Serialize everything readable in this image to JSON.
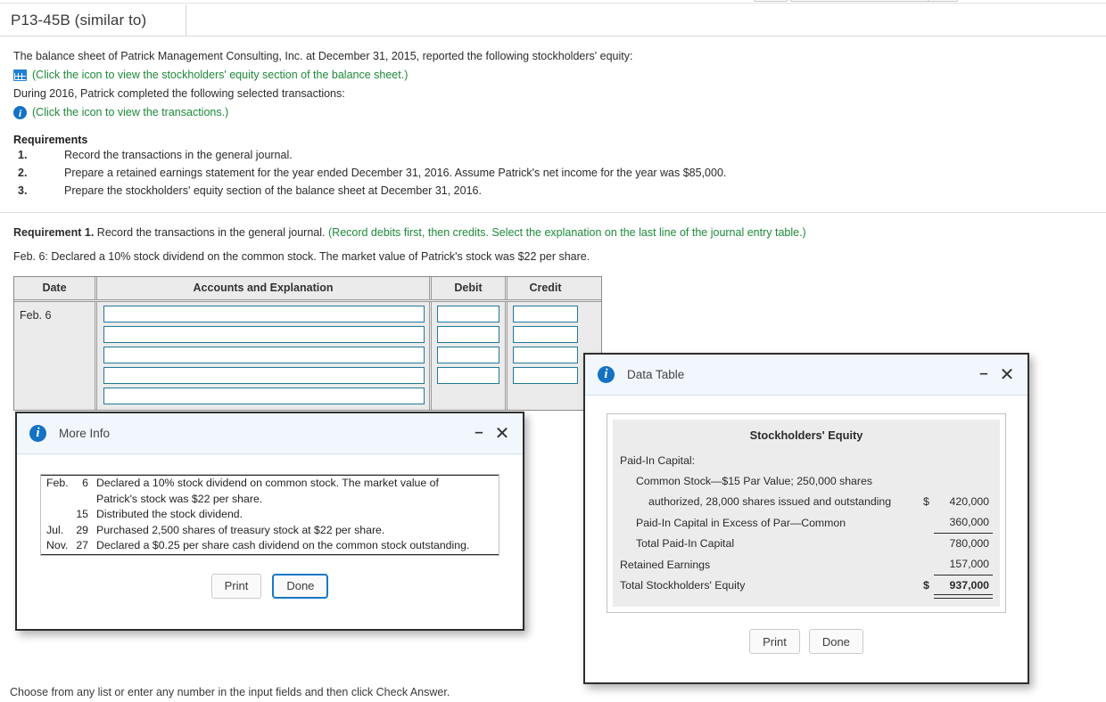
{
  "header": {
    "tab_title": "P13-45B (similar to)"
  },
  "problem": {
    "intro": "The balance sheet of Patrick Management Consulting, Inc. at December 31, 2015, reported the following stockholders' equity:",
    "balance_sheet_link": "(Click the icon to view the stockholders' equity section of the balance sheet.)",
    "balance_sheet_icon": "grid-table-icon",
    "during_line": "During 2016, Patrick completed the following selected transactions:",
    "transactions_link": "(Click the icon to view the transactions.)",
    "transactions_icon": "info-circle-icon",
    "requirements_heading": "Requirements",
    "requirements": [
      {
        "num": "1.",
        "text": "Record the transactions in the general journal."
      },
      {
        "num": "2.",
        "text": "Prepare a retained earnings statement for the year ended December 31, 2016. Assume Patrick's net income for the year was $85,000."
      },
      {
        "num": "3.",
        "text": "Prepare the stockholders' equity section of the balance sheet at December 31, 2016."
      }
    ]
  },
  "requirement1": {
    "label": "Requirement 1.",
    "instruction": "Record the transactions in the general journal.",
    "hint": "(Record debits first, then credits. Select the explanation on the last line of the journal entry table.)",
    "transaction_line": "Feb. 6: Declared a 10% stock dividend on the common stock. The market value of Patrick's stock was $22 per share."
  },
  "journal": {
    "columns": [
      "Date",
      "Accounts and Explanation",
      "Debit",
      "Credit"
    ],
    "date_value": "Feb. 6",
    "row_count": 5,
    "rows": [
      {
        "account": "",
        "debit": "",
        "credit": ""
      },
      {
        "account": "",
        "debit": "",
        "credit": ""
      },
      {
        "account": "",
        "debit": "",
        "credit": ""
      },
      {
        "account": "",
        "debit": "",
        "credit": ""
      },
      {
        "account": "",
        "debit": "",
        "credit": ""
      }
    ]
  },
  "more_info_dialog": {
    "title": "More Info",
    "icon": "info-circle-icon",
    "minimize_glyph": "–",
    "close_glyph": "✕",
    "transactions": [
      {
        "month": "Feb.",
        "day": "6",
        "text": "Declared a 10% stock dividend on common stock. The market value of"
      },
      {
        "month": "",
        "day": "",
        "text": "Patrick's stock was $22 per share."
      },
      {
        "month": "",
        "day": "15",
        "text": "Distributed the stock dividend."
      },
      {
        "month": "Jul.",
        "day": "29",
        "text": "Purchased 2,500 shares of treasury stock at $22 per share."
      },
      {
        "month": "Nov.",
        "day": "27",
        "text": "Declared a $0.25 per share cash dividend on the common stock outstanding."
      }
    ],
    "print_label": "Print",
    "done_label": "Done"
  },
  "data_table_dialog": {
    "title": "Data Table",
    "icon": "info-circle-icon",
    "minimize_glyph": "–",
    "close_glyph": "✕",
    "table_title": "Stockholders' Equity",
    "rows": [
      {
        "label": "Paid-In Capital:",
        "indent": 0,
        "currency": "",
        "amount": "",
        "rule": "none",
        "bold": false
      },
      {
        "label": "Common Stock—$15 Par Value; 250,000 shares",
        "indent": 1,
        "currency": "",
        "amount": "",
        "rule": "none",
        "bold": false
      },
      {
        "label": "authorized, 28,000 shares issued and outstanding",
        "indent": 2,
        "currency": "$",
        "amount": "420,000",
        "rule": "none",
        "bold": false
      },
      {
        "label": "Paid-In Capital in Excess of Par—Common",
        "indent": 1,
        "currency": "",
        "amount": "360,000",
        "rule": "single",
        "bold": false
      },
      {
        "label": "Total Paid-In Capital",
        "indent": 1,
        "currency": "",
        "amount": "780,000",
        "rule": "none",
        "bold": false
      },
      {
        "label": "Retained Earnings",
        "indent": 0,
        "currency": "",
        "amount": "157,000",
        "rule": "single",
        "bold": false
      },
      {
        "label": "Total Stockholders' Equity",
        "indent": 0,
        "currency": "$",
        "amount": "937,000",
        "rule": "double",
        "bold": true
      }
    ],
    "print_label": "Print",
    "done_label": "Done"
  },
  "footer": {
    "note": "Choose from any list or enter any number in the input fields and then click Check Answer."
  },
  "colors": {
    "green_link": "#1d8a3a",
    "blue_icon": "#1472c4",
    "dialog_header": "#f2f7fd",
    "input_border": "#1f7a99",
    "table_bg": "#ebebeb"
  }
}
